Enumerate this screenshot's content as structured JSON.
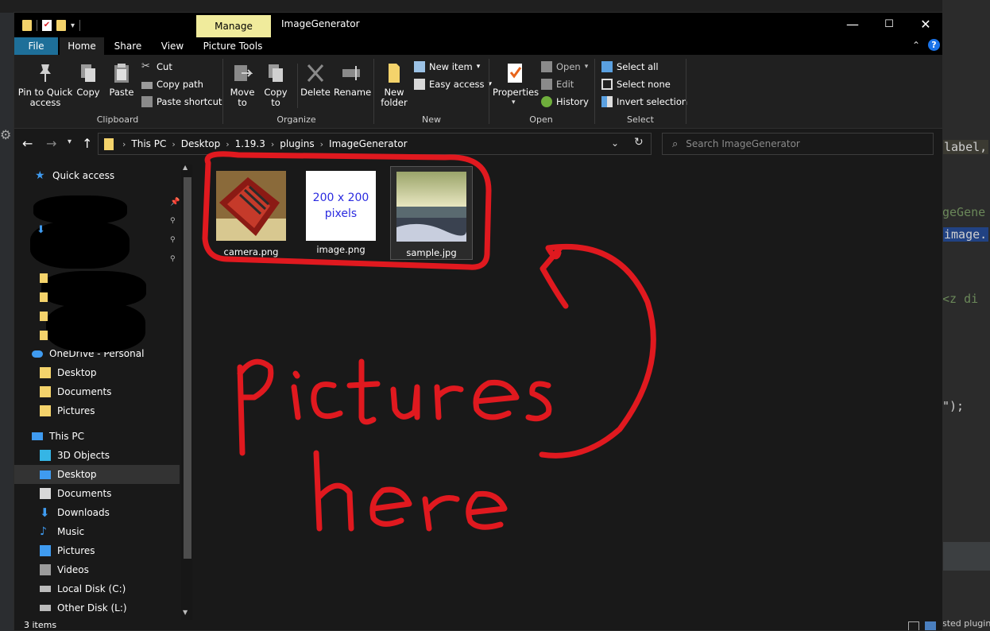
{
  "editor": {
    "code_lines": [
      "label,",
      "geGene",
      "image.",
      " <z di",
      "\");",
      ""
    ],
    "bottom_text": "sted plugin"
  },
  "titlebar": {
    "manage_tab": "Manage",
    "title": "ImageGenerator",
    "min_glyph": "—",
    "max_glyph": "☐",
    "close_glyph": "✕"
  },
  "tabs": [
    "File",
    "Home",
    "Share",
    "View",
    "Picture Tools"
  ],
  "ribbon": {
    "clipboard": {
      "pin": "Pin to Quick access",
      "copy": "Copy",
      "paste": "Paste",
      "cut": "Cut",
      "copy_path": "Copy path",
      "paste_shortcut": "Paste shortcut",
      "label": "Clipboard"
    },
    "organize": {
      "move_to": "Move to",
      "copy_to": "Copy to",
      "delete": "Delete",
      "rename": "Rename",
      "label": "Organize"
    },
    "new": {
      "new_folder": "New folder",
      "new_item": "New item",
      "easy_access": "Easy access",
      "label": "New"
    },
    "open": {
      "properties": "Properties",
      "open": "Open",
      "edit": "Edit",
      "history": "History",
      "label": "Open"
    },
    "select": {
      "select_all": "Select all",
      "select_none": "Select none",
      "invert": "Invert selection",
      "label": "Select"
    }
  },
  "address": {
    "crumbs": [
      "This PC",
      "Desktop",
      "1.19.3",
      "plugins",
      "ImageGenerator"
    ],
    "search_placeholder": "Search ImageGenerator"
  },
  "nav": {
    "quick_access": "Quick access",
    "onedrive": "OneDrive - Personal",
    "onedrive_items": [
      "Desktop",
      "Documents",
      "Pictures"
    ],
    "this_pc": "This PC",
    "pc_items": [
      "3D Objects",
      "Desktop",
      "Documents",
      "Downloads",
      "Music",
      "Pictures",
      "Videos",
      "Local Disk (C:)",
      "Other Disk (L:)"
    ]
  },
  "files": [
    {
      "name": "camera.png"
    },
    {
      "name": "image.png",
      "thumb_text_1": "200 x 200",
      "thumb_text_2": "pixels"
    },
    {
      "name": "sample.jpg"
    }
  ],
  "status": {
    "count": "3 items"
  },
  "colors": {
    "accent_file_tab": "#1e6f99",
    "manage_tab": "#f0eb9c",
    "annotation_red": "#e0191f",
    "folder_yellow": "#f4d36b"
  }
}
